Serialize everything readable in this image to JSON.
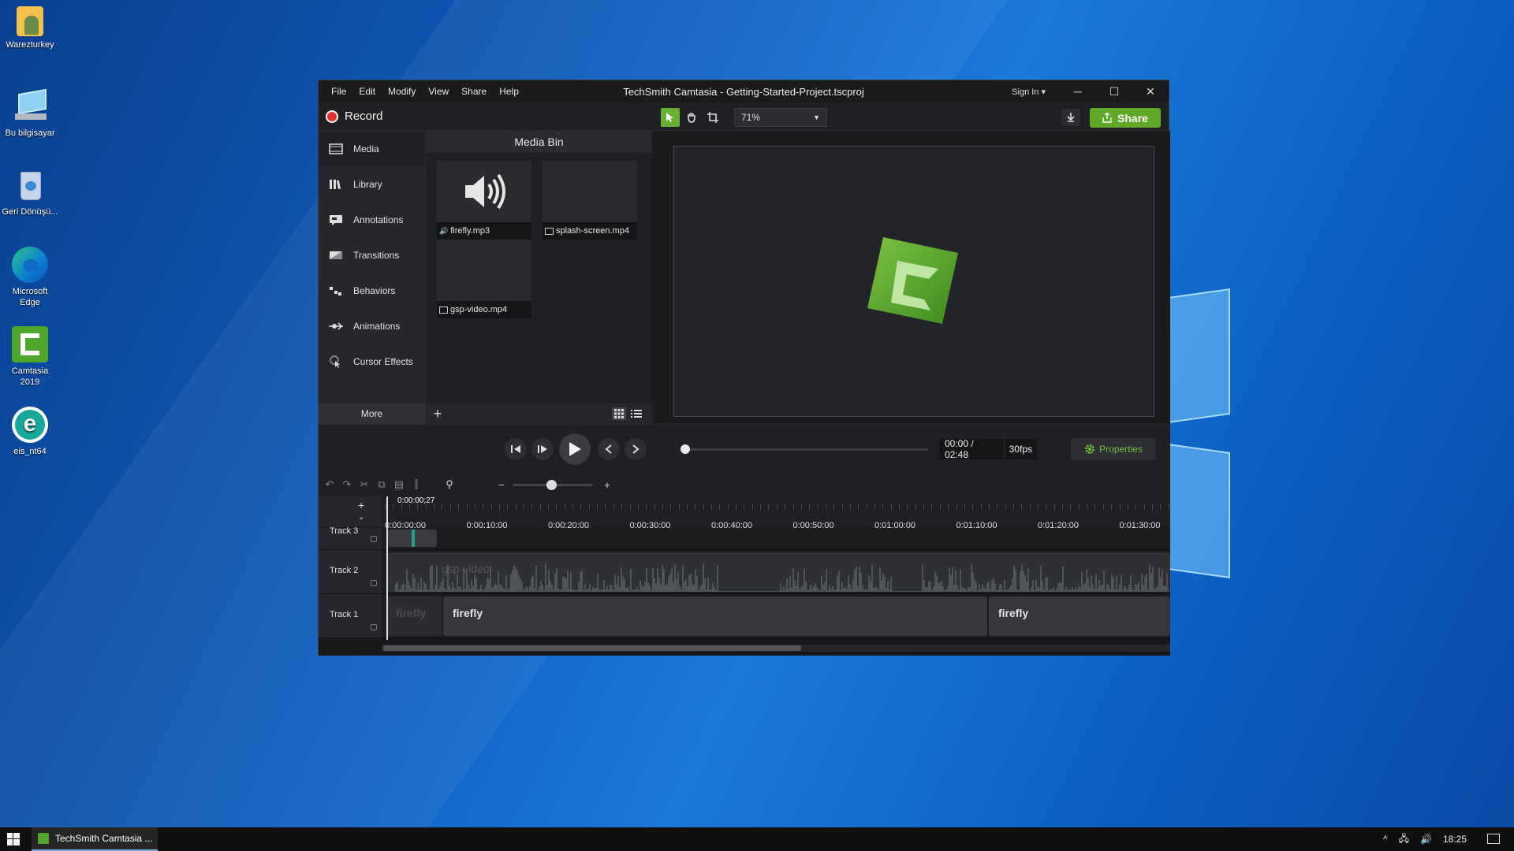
{
  "desktop": {
    "icons": [
      {
        "label": "Warezturkey",
        "icon": "folder-user-icon"
      },
      {
        "label": "Bu bilgisayar",
        "icon": "computer-icon"
      },
      {
        "label": "Geri Dönüşü...",
        "icon": "recycle-bin-icon"
      },
      {
        "label": "Microsoft Edge",
        "icon": "edge-icon"
      },
      {
        "label": "Camtasia 2019",
        "icon": "camtasia-icon"
      },
      {
        "label": "eis_nt64",
        "icon": "eset-icon"
      }
    ]
  },
  "window": {
    "title": "TechSmith Camtasia - Getting-Started-Project.tscproj",
    "menu": [
      "File",
      "Edit",
      "Modify",
      "View",
      "Share",
      "Help"
    ],
    "sign_in": "Sign In ▾",
    "controls": {
      "minimize": "─",
      "maximize": "☐",
      "close": "✕"
    }
  },
  "toolbar": {
    "record_label": "Record",
    "zoom": "71%",
    "share_label": "Share"
  },
  "sidebar": {
    "items": [
      {
        "label": "Media",
        "icon": "media-icon"
      },
      {
        "label": "Library",
        "icon": "library-icon"
      },
      {
        "label": "Annotations",
        "icon": "annotations-icon"
      },
      {
        "label": "Transitions",
        "icon": "transitions-icon"
      },
      {
        "label": "Behaviors",
        "icon": "behaviors-icon"
      },
      {
        "label": "Animations",
        "icon": "animations-icon"
      },
      {
        "label": "Cursor Effects",
        "icon": "cursor-effects-icon"
      }
    ],
    "more_label": "More"
  },
  "media_bin": {
    "title": "Media Bin",
    "items": [
      {
        "name": "firefly.mp3",
        "type": "audio"
      },
      {
        "name": "splash-screen.mp4",
        "type": "video"
      },
      {
        "name": "gsp-video.mp4",
        "type": "video"
      }
    ]
  },
  "player": {
    "time": "00:00 / 02:48",
    "fps": "30fps",
    "properties_label": "Properties",
    "progress": 0
  },
  "timeline": {
    "playhead_time": "0:00:00;27",
    "ruler": [
      "0:00:00;00",
      "0:00:10;00",
      "0:00:20;00",
      "0:00:30;00",
      "0:00:40;00",
      "0:00:50;00",
      "0:01:00;00",
      "0:01:10;00",
      "0:01:20;00",
      "0:01:30;00"
    ],
    "tracks": [
      {
        "name": "Track 3"
      },
      {
        "name": "Track 2",
        "clips": [
          "gsp-video"
        ]
      },
      {
        "name": "Track 1",
        "clips": [
          "firefly",
          "firefly",
          "firefly"
        ]
      }
    ]
  },
  "taskbar": {
    "app_label": "TechSmith Camtasia ...",
    "clock": "18:25"
  },
  "colors": {
    "accent": "#5fa829",
    "record": "#e5312e",
    "desktop": "#1367c8"
  }
}
